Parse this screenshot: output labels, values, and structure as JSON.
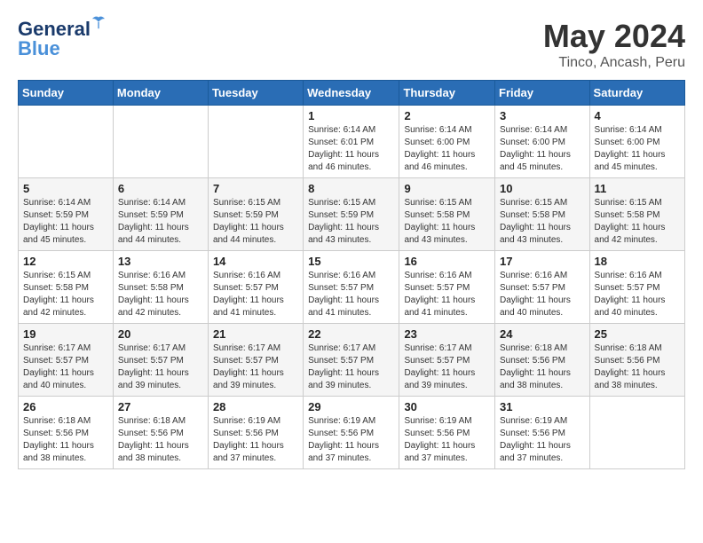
{
  "header": {
    "logo_line1": "General",
    "logo_line2": "Blue",
    "month_title": "May 2024",
    "location": "Tinco, Ancash, Peru"
  },
  "weekdays": [
    "Sunday",
    "Monday",
    "Tuesday",
    "Wednesday",
    "Thursday",
    "Friday",
    "Saturday"
  ],
  "weeks": [
    [
      {
        "day": "",
        "sunrise": "",
        "sunset": "",
        "daylight": ""
      },
      {
        "day": "",
        "sunrise": "",
        "sunset": "",
        "daylight": ""
      },
      {
        "day": "",
        "sunrise": "",
        "sunset": "",
        "daylight": ""
      },
      {
        "day": "1",
        "sunrise": "Sunrise: 6:14 AM",
        "sunset": "Sunset: 6:01 PM",
        "daylight": "Daylight: 11 hours and 46 minutes."
      },
      {
        "day": "2",
        "sunrise": "Sunrise: 6:14 AM",
        "sunset": "Sunset: 6:00 PM",
        "daylight": "Daylight: 11 hours and 46 minutes."
      },
      {
        "day": "3",
        "sunrise": "Sunrise: 6:14 AM",
        "sunset": "Sunset: 6:00 PM",
        "daylight": "Daylight: 11 hours and 45 minutes."
      },
      {
        "day": "4",
        "sunrise": "Sunrise: 6:14 AM",
        "sunset": "Sunset: 6:00 PM",
        "daylight": "Daylight: 11 hours and 45 minutes."
      }
    ],
    [
      {
        "day": "5",
        "sunrise": "Sunrise: 6:14 AM",
        "sunset": "Sunset: 5:59 PM",
        "daylight": "Daylight: 11 hours and 45 minutes."
      },
      {
        "day": "6",
        "sunrise": "Sunrise: 6:14 AM",
        "sunset": "Sunset: 5:59 PM",
        "daylight": "Daylight: 11 hours and 44 minutes."
      },
      {
        "day": "7",
        "sunrise": "Sunrise: 6:15 AM",
        "sunset": "Sunset: 5:59 PM",
        "daylight": "Daylight: 11 hours and 44 minutes."
      },
      {
        "day": "8",
        "sunrise": "Sunrise: 6:15 AM",
        "sunset": "Sunset: 5:59 PM",
        "daylight": "Daylight: 11 hours and 43 minutes."
      },
      {
        "day": "9",
        "sunrise": "Sunrise: 6:15 AM",
        "sunset": "Sunset: 5:58 PM",
        "daylight": "Daylight: 11 hours and 43 minutes."
      },
      {
        "day": "10",
        "sunrise": "Sunrise: 6:15 AM",
        "sunset": "Sunset: 5:58 PM",
        "daylight": "Daylight: 11 hours and 43 minutes."
      },
      {
        "day": "11",
        "sunrise": "Sunrise: 6:15 AM",
        "sunset": "Sunset: 5:58 PM",
        "daylight": "Daylight: 11 hours and 42 minutes."
      }
    ],
    [
      {
        "day": "12",
        "sunrise": "Sunrise: 6:15 AM",
        "sunset": "Sunset: 5:58 PM",
        "daylight": "Daylight: 11 hours and 42 minutes."
      },
      {
        "day": "13",
        "sunrise": "Sunrise: 6:16 AM",
        "sunset": "Sunset: 5:58 PM",
        "daylight": "Daylight: 11 hours and 42 minutes."
      },
      {
        "day": "14",
        "sunrise": "Sunrise: 6:16 AM",
        "sunset": "Sunset: 5:57 PM",
        "daylight": "Daylight: 11 hours and 41 minutes."
      },
      {
        "day": "15",
        "sunrise": "Sunrise: 6:16 AM",
        "sunset": "Sunset: 5:57 PM",
        "daylight": "Daylight: 11 hours and 41 minutes."
      },
      {
        "day": "16",
        "sunrise": "Sunrise: 6:16 AM",
        "sunset": "Sunset: 5:57 PM",
        "daylight": "Daylight: 11 hours and 41 minutes."
      },
      {
        "day": "17",
        "sunrise": "Sunrise: 6:16 AM",
        "sunset": "Sunset: 5:57 PM",
        "daylight": "Daylight: 11 hours and 40 minutes."
      },
      {
        "day": "18",
        "sunrise": "Sunrise: 6:16 AM",
        "sunset": "Sunset: 5:57 PM",
        "daylight": "Daylight: 11 hours and 40 minutes."
      }
    ],
    [
      {
        "day": "19",
        "sunrise": "Sunrise: 6:17 AM",
        "sunset": "Sunset: 5:57 PM",
        "daylight": "Daylight: 11 hours and 40 minutes."
      },
      {
        "day": "20",
        "sunrise": "Sunrise: 6:17 AM",
        "sunset": "Sunset: 5:57 PM",
        "daylight": "Daylight: 11 hours and 39 minutes."
      },
      {
        "day": "21",
        "sunrise": "Sunrise: 6:17 AM",
        "sunset": "Sunset: 5:57 PM",
        "daylight": "Daylight: 11 hours and 39 minutes."
      },
      {
        "day": "22",
        "sunrise": "Sunrise: 6:17 AM",
        "sunset": "Sunset: 5:57 PM",
        "daylight": "Daylight: 11 hours and 39 minutes."
      },
      {
        "day": "23",
        "sunrise": "Sunrise: 6:17 AM",
        "sunset": "Sunset: 5:57 PM",
        "daylight": "Daylight: 11 hours and 39 minutes."
      },
      {
        "day": "24",
        "sunrise": "Sunrise: 6:18 AM",
        "sunset": "Sunset: 5:56 PM",
        "daylight": "Daylight: 11 hours and 38 minutes."
      },
      {
        "day": "25",
        "sunrise": "Sunrise: 6:18 AM",
        "sunset": "Sunset: 5:56 PM",
        "daylight": "Daylight: 11 hours and 38 minutes."
      }
    ],
    [
      {
        "day": "26",
        "sunrise": "Sunrise: 6:18 AM",
        "sunset": "Sunset: 5:56 PM",
        "daylight": "Daylight: 11 hours and 38 minutes."
      },
      {
        "day": "27",
        "sunrise": "Sunrise: 6:18 AM",
        "sunset": "Sunset: 5:56 PM",
        "daylight": "Daylight: 11 hours and 38 minutes."
      },
      {
        "day": "28",
        "sunrise": "Sunrise: 6:19 AM",
        "sunset": "Sunset: 5:56 PM",
        "daylight": "Daylight: 11 hours and 37 minutes."
      },
      {
        "day": "29",
        "sunrise": "Sunrise: 6:19 AM",
        "sunset": "Sunset: 5:56 PM",
        "daylight": "Daylight: 11 hours and 37 minutes."
      },
      {
        "day": "30",
        "sunrise": "Sunrise: 6:19 AM",
        "sunset": "Sunset: 5:56 PM",
        "daylight": "Daylight: 11 hours and 37 minutes."
      },
      {
        "day": "31",
        "sunrise": "Sunrise: 6:19 AM",
        "sunset": "Sunset: 5:56 PM",
        "daylight": "Daylight: 11 hours and 37 minutes."
      },
      {
        "day": "",
        "sunrise": "",
        "sunset": "",
        "daylight": ""
      }
    ]
  ]
}
